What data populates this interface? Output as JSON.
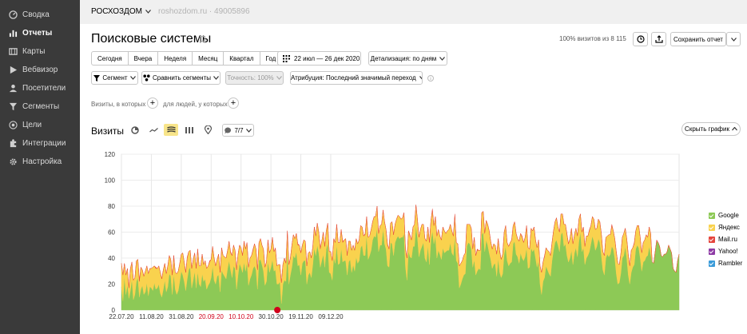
{
  "sidebar": {
    "items": [
      {
        "label": "Сводка",
        "icon": "dashboard-icon"
      },
      {
        "label": "Отчеты",
        "icon": "bar-chart-icon",
        "active": true
      },
      {
        "label": "Карты",
        "icon": "map-icon"
      },
      {
        "label": "Вебвизор",
        "icon": "play-icon"
      },
      {
        "label": "Посетители",
        "icon": "person-icon"
      },
      {
        "label": "Сегменты",
        "icon": "funnel-icon"
      },
      {
        "label": "Цели",
        "icon": "target-icon"
      },
      {
        "label": "Интеграции",
        "icon": "puzzle-icon"
      },
      {
        "label": "Настройка",
        "icon": "gear-icon"
      }
    ]
  },
  "topbar": {
    "org": "РОСХОЗДОМ",
    "site": "roshozdom.ru · 49005896"
  },
  "header": {
    "title": "Поисковые системы",
    "visits_share": "100% визитов из 8 115",
    "save_label": "Сохранить отчет"
  },
  "period": {
    "options": [
      "Сегодня",
      "Вчера",
      "Неделя",
      "Месяц",
      "Квартал",
      "Год"
    ],
    "range": "22 июл — 26 дек 2020",
    "detail": "Детализация: по дням"
  },
  "filters": {
    "segment": "Сегмент",
    "compare": "Сравнить сегменты",
    "accuracy": "Точность: 100%",
    "attribution": "Атрибуция: Последний значимый переход",
    "visits_in": "Визиты, в которых",
    "people_with": "для людей, у которых"
  },
  "chart_header": {
    "title": "Визиты",
    "series_count": "7/7",
    "hide_chart": "Скрыть график"
  },
  "chart_data": {
    "type": "area",
    "stacked": true,
    "title": "Визиты",
    "ylim": [
      0,
      120
    ],
    "yticks": [
      0,
      20,
      40,
      60,
      80,
      100,
      120
    ],
    "xtick_labels": [
      {
        "label": "22.07.20",
        "weekend": false
      },
      {
        "label": "11.08.20",
        "weekend": false
      },
      {
        "label": "31.08.20",
        "weekend": false
      },
      {
        "label": "20.09.20",
        "weekend": true
      },
      {
        "label": "10.10.20",
        "weekend": true
      },
      {
        "label": "30.10.20",
        "weekend": false
      },
      {
        "label": "19.11.20",
        "weekend": false
      },
      {
        "label": "09.12.20",
        "weekend": false
      }
    ],
    "x_start": "22.07.20",
    "x_end": "26.12.20",
    "grid": true,
    "legend_position": "right",
    "series": [
      {
        "name": "Google",
        "color": "#8dc956",
        "values": [
          18,
          7,
          26,
          12,
          20,
          9,
          15,
          24,
          8,
          12,
          22,
          25,
          10,
          16,
          19,
          12,
          14,
          21,
          11,
          18,
          17,
          15,
          21,
          16,
          17,
          20,
          13,
          10,
          16,
          23,
          14,
          18,
          28,
          26,
          12,
          28,
          16,
          12,
          15,
          22,
          30,
          27,
          22,
          15,
          24,
          31,
          33,
          17,
          23,
          30,
          17,
          30,
          20,
          18,
          28,
          22,
          24,
          16,
          19,
          21,
          25,
          34,
          23,
          20,
          26,
          27,
          14,
          31,
          28,
          26,
          24,
          32,
          38,
          31,
          25,
          34,
          32,
          16,
          27,
          36,
          33,
          29,
          37,
          30,
          37,
          19,
          24,
          27,
          32,
          34,
          31,
          16,
          38,
          39,
          35,
          30,
          19,
          22,
          38,
          29,
          33,
          39,
          30,
          31,
          20,
          20,
          22,
          5,
          20,
          23,
          22,
          45,
          20,
          27,
          33,
          42,
          40,
          45,
          34,
          35,
          27,
          36,
          38,
          38,
          20,
          27,
          29,
          25,
          35,
          48,
          42,
          50,
          44,
          33,
          38,
          43,
          33,
          47,
          52,
          29,
          28,
          23,
          41,
          36,
          51,
          35,
          36,
          48,
          37,
          38,
          38,
          27,
          37,
          39,
          29,
          35,
          30,
          41,
          36,
          38,
          48,
          50,
          42,
          42,
          58,
          39,
          42,
          46,
          54,
          57,
          56,
          63,
          45,
          50,
          50,
          63,
          51,
          47,
          34,
          33,
          52,
          51,
          42,
          52,
          55,
          57,
          55,
          56,
          56,
          59,
          33,
          23,
          46,
          41,
          40,
          49,
          49,
          65,
          56,
          41,
          46,
          49,
          52,
          40,
          37,
          50,
          35,
          54,
          61,
          51,
          57,
          40,
          46,
          43,
          39,
          48,
          44,
          45,
          46,
          46,
          52,
          44,
          42,
          57,
          38,
          36,
          17,
          20,
          24,
          27,
          28,
          49,
          52,
          51,
          47,
          33,
          39,
          27,
          30,
          32,
          31,
          58,
          60,
          45,
          54,
          50,
          44,
          39,
          32,
          35,
          36,
          26,
          40,
          29,
          25,
          28,
          43,
          49,
          38,
          34,
          36,
          37,
          51,
          53,
          43,
          41,
          36,
          44,
          40,
          38,
          41,
          48,
          32,
          33,
          48,
          45,
          47,
          40,
          33,
          38,
          20,
          12,
          22,
          25,
          34,
          31,
          28,
          26,
          38,
          46,
          52,
          54,
          50,
          45,
          58,
          60,
          49,
          51,
          42,
          37,
          40,
          46,
          35,
          44,
          48,
          41,
          53,
          60,
          45,
          48,
          35,
          40,
          42,
          45,
          51,
          57,
          53,
          46,
          49,
          55,
          52,
          42,
          31,
          27,
          40,
          43,
          41,
          43,
          49,
          47,
          40,
          28,
          20,
          21,
          28,
          40,
          42,
          49,
          40,
          27,
          20,
          29,
          33,
          35,
          47,
          50,
          48,
          40,
          30,
          37,
          38,
          41,
          42,
          49,
          43,
          37,
          36,
          45,
          53,
          52,
          49,
          42,
          41,
          43,
          43,
          45,
          50,
          47,
          44,
          32,
          30,
          29,
          38,
          43
        ]
      },
      {
        "name": "Яндекс",
        "color": "#f9d24e",
        "values": [
          18,
          20,
          10,
          15,
          12,
          8,
          17,
          13,
          15,
          13,
          16,
          14,
          12,
          17,
          12,
          14,
          16,
          13,
          17,
          14,
          15,
          18,
          13,
          16,
          15,
          14,
          16,
          14,
          15,
          13,
          14,
          16,
          14,
          13,
          15,
          14,
          13,
          16,
          15,
          14,
          13,
          17,
          15,
          14,
          16,
          14,
          13,
          15,
          16,
          14,
          15,
          17,
          14,
          16,
          15,
          13,
          14,
          16,
          15,
          16,
          14,
          15,
          17,
          14,
          13,
          16,
          15,
          17,
          14,
          15,
          16,
          14,
          15,
          13,
          17,
          16,
          14,
          15,
          16,
          14,
          15,
          13,
          16,
          17,
          15,
          14,
          16,
          15,
          14,
          17,
          16,
          15,
          14,
          16,
          15,
          17,
          14,
          15,
          16,
          15,
          14,
          17,
          15,
          16,
          14,
          15,
          13,
          16,
          15,
          17,
          14,
          16,
          15,
          13,
          17,
          16,
          15,
          14,
          16,
          15,
          17,
          14,
          16,
          15,
          14,
          17,
          16,
          15,
          14,
          16,
          15,
          17,
          16,
          14,
          15,
          17,
          16,
          14,
          15,
          16,
          17,
          15,
          14,
          16,
          15,
          17,
          16,
          14,
          15,
          16,
          17,
          15,
          16,
          14,
          17,
          15,
          16,
          14,
          15,
          16,
          17,
          14,
          15,
          16,
          14,
          17,
          15,
          16,
          14,
          15,
          16,
          17,
          14,
          15,
          16,
          14,
          17,
          15,
          16,
          14,
          15,
          17,
          16,
          14,
          15,
          16,
          17,
          14,
          15,
          16,
          14,
          17,
          15,
          16,
          14,
          15,
          17,
          16,
          14,
          15,
          16,
          17,
          14,
          15,
          16,
          14,
          17,
          15,
          16,
          14,
          15,
          17,
          16,
          14,
          15,
          16,
          17,
          14,
          15,
          16,
          14,
          17,
          15,
          16,
          14,
          15,
          17,
          16,
          14,
          15,
          16,
          17,
          14,
          15,
          16,
          14,
          17,
          15,
          16,
          14,
          15,
          17,
          16,
          14,
          15,
          16,
          17,
          14,
          15,
          16,
          14,
          17,
          15,
          16,
          14,
          15,
          17,
          16,
          14,
          15,
          16,
          17,
          14,
          15,
          16,
          14,
          17,
          15,
          16,
          14,
          15,
          17,
          16,
          14,
          15,
          16,
          17,
          14,
          15,
          16,
          14,
          17,
          15,
          16,
          14,
          15,
          17,
          16,
          14,
          15,
          16,
          17,
          14,
          15,
          16,
          14,
          17,
          15,
          16,
          14,
          15,
          17,
          16,
          14,
          15,
          16,
          17,
          14,
          15,
          16,
          14,
          17,
          15,
          16,
          14,
          15,
          17,
          16,
          14,
          15,
          16,
          17,
          14,
          15,
          16,
          14,
          17,
          15,
          16,
          14,
          15,
          17,
          16,
          14,
          15,
          16,
          17,
          14,
          15,
          16,
          14,
          17,
          15,
          16,
          14,
          15,
          17,
          16,
          14,
          15,
          16,
          17,
          14,
          15,
          16
        ]
      },
      {
        "name": "Mail.ru",
        "color": "#e5463e",
        "values": [
          0,
          0,
          0,
          0,
          0,
          0,
          0,
          0,
          0,
          0,
          0,
          0,
          1,
          0,
          0,
          0,
          0,
          0,
          0,
          0,
          0,
          0,
          0,
          1,
          0,
          0,
          0,
          0,
          0,
          0,
          0,
          0,
          0,
          0,
          0,
          0,
          0,
          0,
          0,
          0,
          0,
          0,
          0,
          0,
          1,
          0,
          0,
          0,
          0,
          0,
          0,
          0,
          0,
          0,
          0,
          0,
          0,
          0,
          0,
          1,
          0,
          0,
          0,
          0,
          0,
          0,
          0,
          0,
          0,
          0,
          0,
          0,
          0,
          1,
          0,
          0,
          0,
          0,
          0,
          0,
          0,
          0,
          0,
          0,
          0,
          0,
          0,
          0,
          1,
          0,
          0,
          0,
          0,
          0,
          0,
          0,
          0,
          0,
          0,
          0,
          0,
          0,
          0,
          1,
          0,
          0,
          0,
          0,
          0,
          0,
          0,
          0,
          0,
          0,
          0,
          0,
          0,
          0,
          1,
          0,
          0,
          0,
          0,
          0,
          0,
          0,
          0,
          0,
          0,
          0,
          0,
          0,
          0,
          1,
          0,
          0,
          0,
          0,
          0,
          0,
          0,
          0,
          0,
          0,
          0,
          0,
          0,
          0,
          1,
          0,
          0,
          0,
          0,
          0,
          0,
          0,
          0,
          0,
          0,
          0,
          0,
          0,
          0,
          1,
          0,
          0,
          0,
          0,
          0,
          0,
          0,
          0,
          0,
          0,
          0,
          0,
          0,
          0,
          1,
          0,
          0,
          0,
          0,
          0,
          0,
          0,
          0,
          0,
          0,
          0,
          0,
          0,
          0,
          1,
          0,
          0,
          0,
          0,
          0,
          0,
          0,
          0,
          0,
          0,
          0,
          0,
          0,
          0,
          1,
          0,
          0,
          0,
          0,
          0,
          0,
          0,
          0,
          0,
          0,
          0,
          0,
          0,
          0,
          1,
          0,
          0,
          0,
          0,
          0,
          0,
          0,
          0,
          0,
          0,
          0,
          0,
          0,
          0,
          1,
          0,
          0,
          0,
          0,
          0,
          0,
          0,
          0,
          0,
          0,
          0,
          0,
          0,
          0,
          1,
          0,
          0,
          0,
          0,
          0,
          0,
          0,
          0,
          0,
          0,
          0,
          0,
          0,
          0,
          1,
          0,
          0,
          0,
          0,
          0,
          0,
          0,
          0,
          0,
          0,
          0,
          0,
          0,
          0,
          1,
          0,
          0,
          0,
          0,
          0,
          0,
          0,
          0,
          0,
          0,
          0,
          0,
          0,
          0,
          1,
          0,
          0,
          0,
          0,
          0,
          0,
          0,
          0,
          0,
          0,
          0,
          0,
          0,
          0,
          1,
          0,
          0,
          0,
          0,
          0,
          0,
          0,
          0,
          0,
          0,
          0,
          0,
          0,
          0,
          1,
          0,
          0,
          0,
          0,
          0,
          0,
          0,
          0,
          0,
          0,
          0,
          0,
          0,
          0,
          1,
          0,
          0,
          0,
          0,
          0,
          0,
          0,
          0,
          0,
          0,
          0,
          0,
          0,
          0,
          1,
          0,
          0,
          0,
          0,
          0,
          0,
          0,
          0,
          0,
          0,
          0,
          0
        ]
      },
      {
        "name": "Yahoo!",
        "color": "#8e3ba5",
        "values": []
      },
      {
        "name": "Rambler",
        "color": "#3a9bd9",
        "values": []
      }
    ]
  }
}
